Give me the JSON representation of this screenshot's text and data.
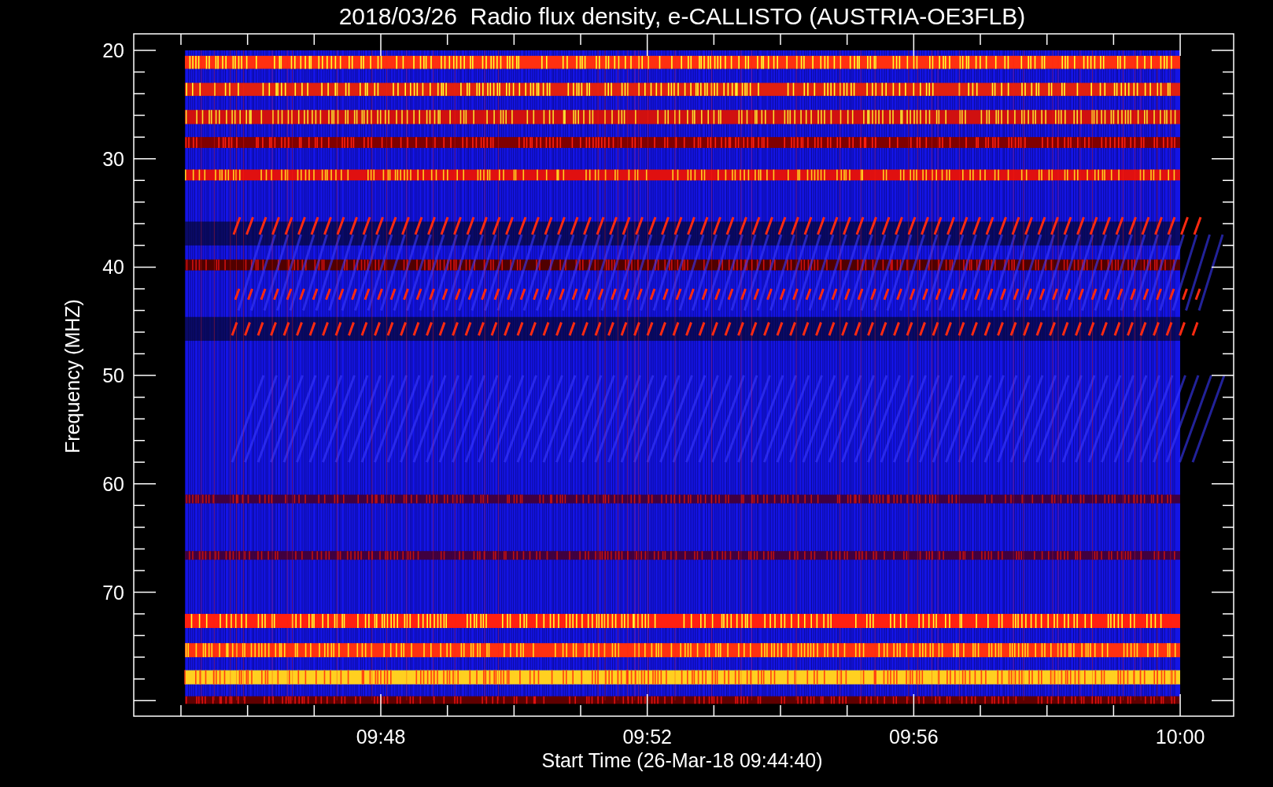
{
  "title": "2018/03/26  Radio flux density, e-CALLISTO (AUSTRIA-OE3FLB)",
  "y_axis": {
    "label": "Frequency (MHZ)",
    "ticks": [
      "20",
      "30",
      "40",
      "50",
      "60",
      "70"
    ]
  },
  "x_axis": {
    "label": "Start Time (26-Mar-18 09:44:40)",
    "ticks": [
      "09:48",
      "09:52",
      "09:56",
      "10:00"
    ]
  }
}
